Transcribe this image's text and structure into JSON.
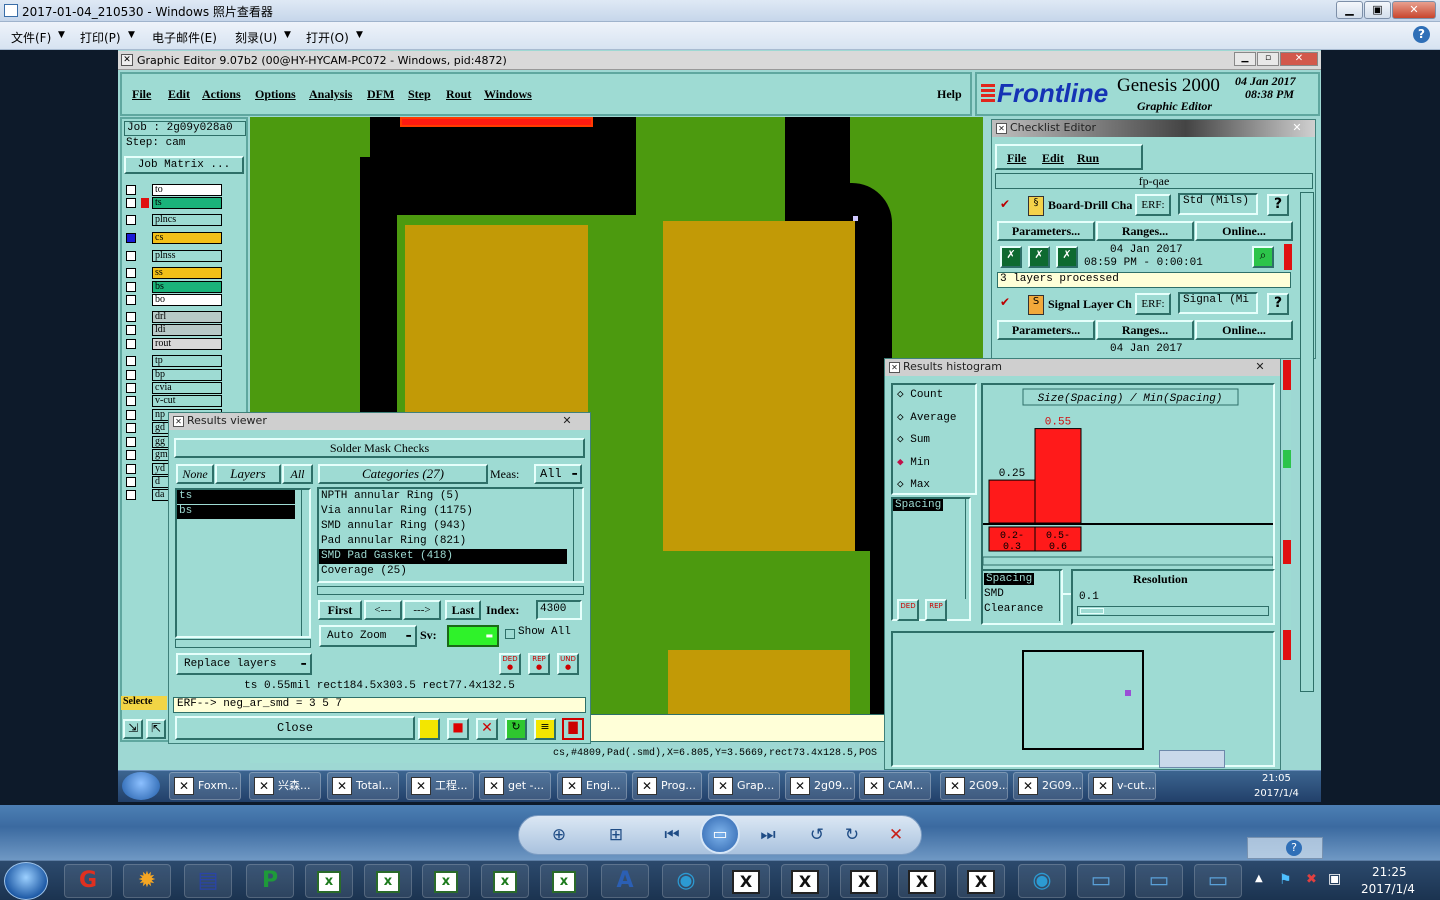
{
  "viewer": {
    "title": "2017-01-04_210530 - Windows 照片查看器",
    "menu": [
      "文件(F)",
      "打印(P)",
      "电子邮件(E)",
      "刻录(U)",
      "打开(O)"
    ],
    "help": "?"
  },
  "ge": {
    "title": "Graphic Editor 9.07b2 (00@HY-HYCAM-PC072 - Windows, pid:4872)",
    "menu": [
      "File",
      "Edit",
      "Actions",
      "Options",
      "Analysis",
      "DFM",
      "Step",
      "Rout",
      "Windows"
    ],
    "help": "Help",
    "logo": {
      "brand": "Frontline",
      "product": "Genesis 2000",
      "sub": "Graphic Editor",
      "date": "04 Jan 2017",
      "time": "08:38 PM"
    }
  },
  "left_panel": {
    "job": "Job : 2g09y028a0",
    "step": "Step: cam",
    "job_matrix": "Job Matrix ...",
    "layers": [
      "to",
      "ts",
      "plncs",
      "cs",
      "plnss",
      "ss",
      "bs",
      "bo",
      "drl",
      "ldi",
      "rout",
      "tp",
      "bp",
      "cvia",
      "v-cut",
      "np",
      "gd",
      "gg",
      "gm",
      "yd",
      "d",
      "da"
    ],
    "selected_label": "Selecte"
  },
  "status_line": "cs,#4809,Pad(.smd),X=6.805,Y=3.5669,rect73.4x128.5,POS",
  "results_viewer": {
    "title": "Results viewer",
    "header": "Solder Mask Checks",
    "tabs": {
      "none": "None",
      "layers": "Layers",
      "all": "All"
    },
    "categories_label": "Categories (27)",
    "meas_label": "Meas:",
    "meas_value": "All",
    "layers": [
      "ts",
      "bs"
    ],
    "categories": [
      "NPTH annular Ring (5)",
      "Via annular Ring (1175)",
      "SMD annular Ring (943)",
      "Pad annular Ring (821)",
      "SMD Pad Gasket (418)",
      "Coverage (25)"
    ],
    "nav": {
      "first": "First",
      "prev": "<---",
      "next": "--->",
      "last": "Last",
      "index_label": "Index:",
      "index_value": "4300"
    },
    "auto_zoom": "Auto Zoom",
    "sv": "Sv:",
    "show_all": "Show All",
    "replace_layers": "Replace layers",
    "info": "ts 0.55mil   rect184.5x303.5   rect77.4x132.5",
    "erf": "ERF--> neg_ar_smd = 3 5 7",
    "close": "Close"
  },
  "checklist": {
    "title": "Checklist Editor",
    "menu": [
      "File",
      "Edit",
      "Run"
    ],
    "name": "fp-qae",
    "items": [
      {
        "name": "Board-Drill Cha",
        "erf": "ERF:",
        "erf_value": "Std (Mils)",
        "params": "Parameters...",
        "ranges": "Ranges...",
        "online": "Online...",
        "date": "04 Jan 2017",
        "time": "08:59 PM - 0:00:01",
        "status": "3 layers processed"
      },
      {
        "name": "Signal Layer Ch",
        "erf": "ERF:",
        "erf_value": "Signal (Mi",
        "params": "Parameters...",
        "ranges": "Ranges...",
        "online": "Online...",
        "date": "04 Jan 2017"
      }
    ]
  },
  "histogram": {
    "title": "Results histogram",
    "modes": [
      "Count",
      "Average",
      "Sum",
      "Min",
      "Max"
    ],
    "selected_mode": "Min",
    "category": "Spacing",
    "chart_title": "Size(Spacing) / Min(Spacing)",
    "measure_list": [
      "Spacing",
      "SMD",
      "Clearance"
    ],
    "resolution_label": "Resolution",
    "resolution_value": "0.1",
    "ded": "DED",
    "rep": "REP"
  },
  "chart_data": {
    "type": "bar",
    "title": "Size(Spacing) / Min(Spacing)",
    "categories": [
      "0.2-\n0.3",
      "0.5-\n0.6"
    ],
    "category_labels": [
      "0.2-",
      "0.5-"
    ],
    "category_labels_2": [
      "0.3",
      "0.6"
    ],
    "values": [
      0.25,
      0.55
    ],
    "value_labels": [
      "0.25",
      "0.55"
    ],
    "ylim": [
      0,
      0.6
    ],
    "bar_color": "#ff1a1a"
  },
  "inner_taskbar": {
    "items": [
      "Foxm...",
      "兴森...",
      "Total...",
      "工程...",
      "get -...",
      "Engi...",
      "Prog...",
      "Grap...",
      "2g09...",
      "CAM...",
      "2G09...",
      "2G09...",
      "v-cut..."
    ],
    "time": "21:05",
    "date": "2017/1/4"
  },
  "taskbar": {
    "time": "21:25",
    "date": "2017/1/4"
  }
}
